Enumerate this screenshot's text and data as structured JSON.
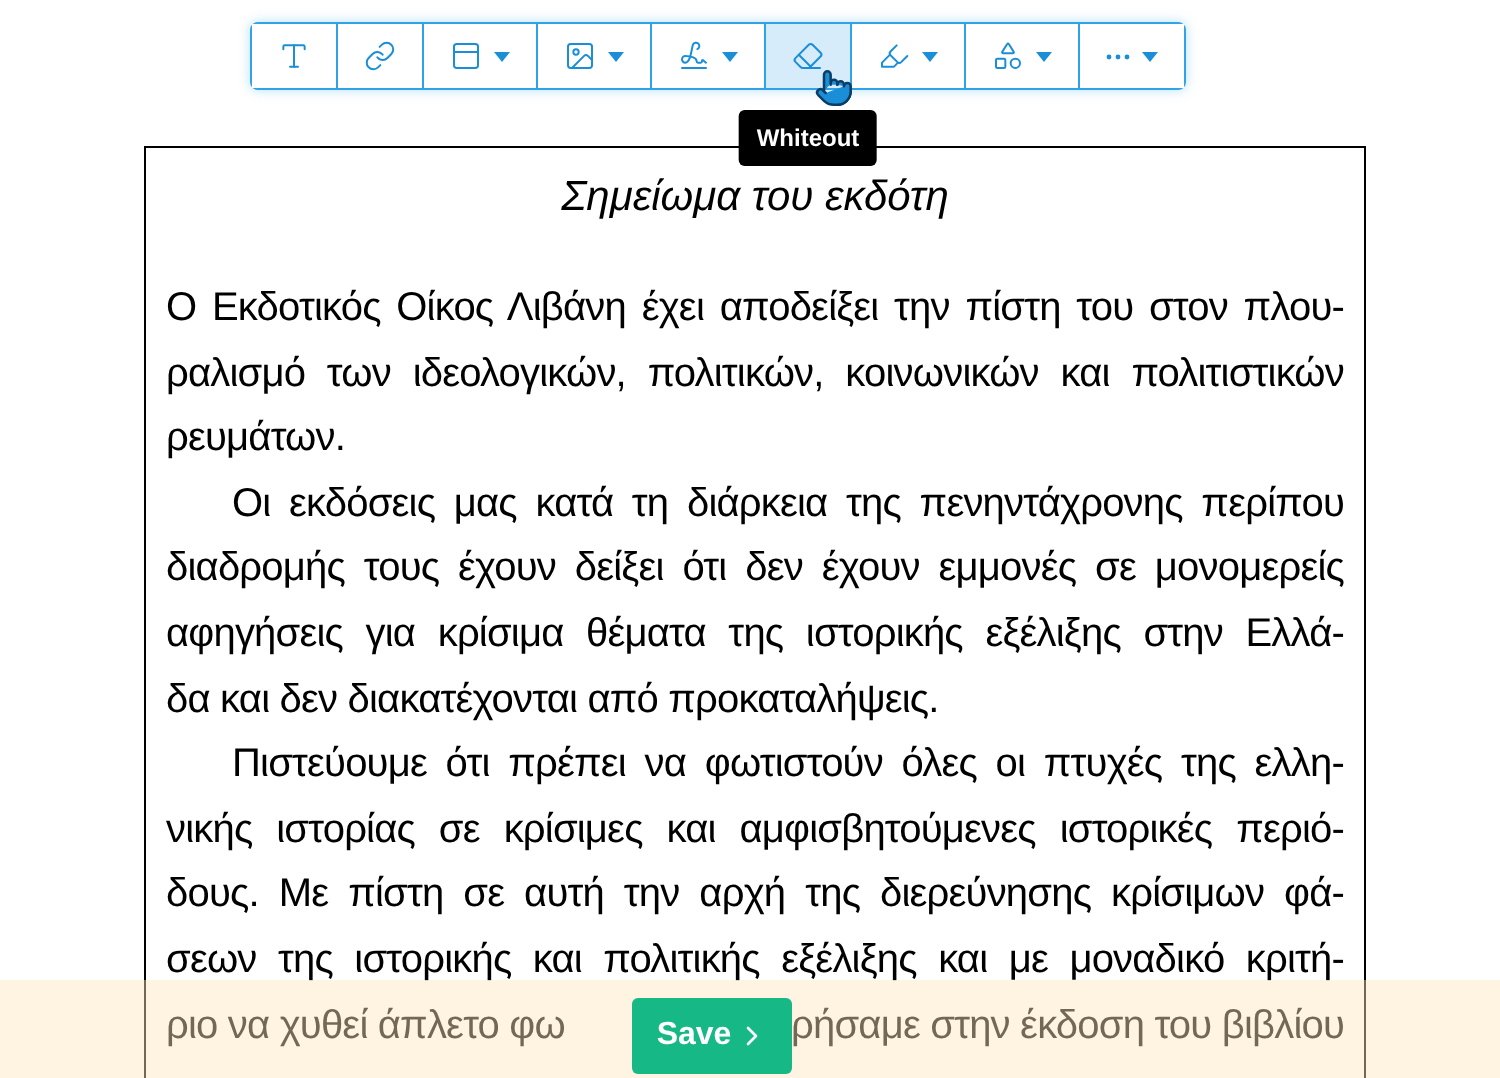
{
  "toolbar": {
    "tools": [
      {
        "kind": "text",
        "dropdown": false,
        "selected": false
      },
      {
        "kind": "link",
        "dropdown": false,
        "selected": false
      },
      {
        "kind": "form",
        "dropdown": true,
        "selected": false
      },
      {
        "kind": "image",
        "dropdown": true,
        "selected": false
      },
      {
        "kind": "signature",
        "dropdown": true,
        "selected": false
      },
      {
        "kind": "eraser",
        "dropdown": false,
        "selected": true
      },
      {
        "kind": "highlighter",
        "dropdown": true,
        "selected": false
      },
      {
        "kind": "shapes",
        "dropdown": true,
        "selected": false
      },
      {
        "kind": "more",
        "dropdown": true,
        "selected": false
      }
    ],
    "tooltip": "Whiteout"
  },
  "document": {
    "title": "Σημείωμα του εκδότη",
    "paragraphs": [
      {
        "indent": false,
        "lines": [
          "Ο Εκδοτικός Οίκος Λιβάνη έχει αποδείξει την πίστη του στον πλου-",
          "ραλισμό των ιδεολογικών, πολιτικών, κοινωνικών και πολιτιστικών",
          "ρευμάτων."
        ]
      },
      {
        "indent": true,
        "lines": [
          "Οι εκδόσεις μας κατά τη διάρκεια της πενηντάχρονης περίπου",
          "διαδρομής τους έχουν δείξει ότι δεν έχουν εμμονές σε μονομερείς",
          "αφηγήσεις για κρίσιμα θέματα της ιστορικής εξέλιξης στην Ελλά-",
          "δα και δεν διακατέχονται από προκαταλήψεις."
        ]
      },
      {
        "indent": true,
        "lines": [
          "Πιστεύουμε ότι πρέπει να φωτιστούν όλες οι πτυχές της ελλη-",
          "νικής ιστορίας σε κρίσιμες και αμφισβητούμενες ιστορικές περιό-",
          "δους. Με πίστη σε αυτή την αρχή της διερεύνησης κρίσιμων φά-",
          "σεων της ιστορικής και πολιτικής εξέλιξης και με μοναδικό κριτή-"
        ]
      }
    ],
    "covered_line": [
      "ριο να χυθεί άπλετο φω",
      "ρήσαμε στην έκδοση του βιβλίου"
    ]
  },
  "save_button": {
    "label": "Save"
  }
}
